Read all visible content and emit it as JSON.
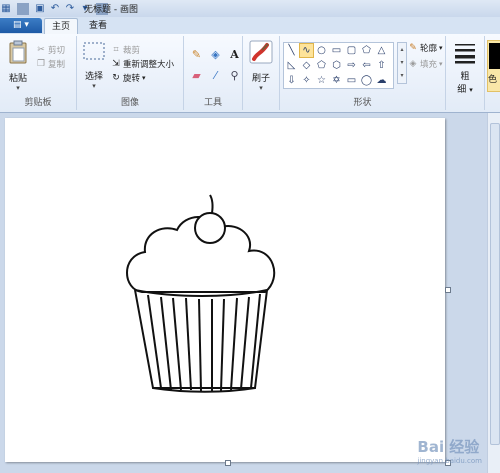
{
  "window": {
    "title": "无标题 - 画图"
  },
  "quick_access": [
    "save-icon",
    "undo-icon",
    "redo-icon",
    "customize-icon"
  ],
  "tabs": [
    {
      "label": "主页",
      "active": true
    },
    {
      "label": "查看",
      "active": false
    }
  ],
  "clipboard": {
    "paste": "粘贴",
    "cut": "剪切",
    "copy": "复制",
    "group": "剪贴板"
  },
  "image": {
    "select": "选择",
    "crop": "裁剪",
    "resize": "重新调整大小",
    "rotate": "旋转",
    "group": "图像"
  },
  "tools": {
    "group": "工具"
  },
  "brushes": {
    "label": "刷子"
  },
  "shapes": {
    "outline": "轮廓",
    "fill": "填充",
    "group": "形状"
  },
  "size": {
    "label": "粗",
    "label2": "细"
  },
  "colors": {
    "color1_label": "色",
    "active_color": "#000000"
  },
  "watermark": {
    "text": "Bai 经验",
    "sub": "jingyan.baidu.com"
  }
}
